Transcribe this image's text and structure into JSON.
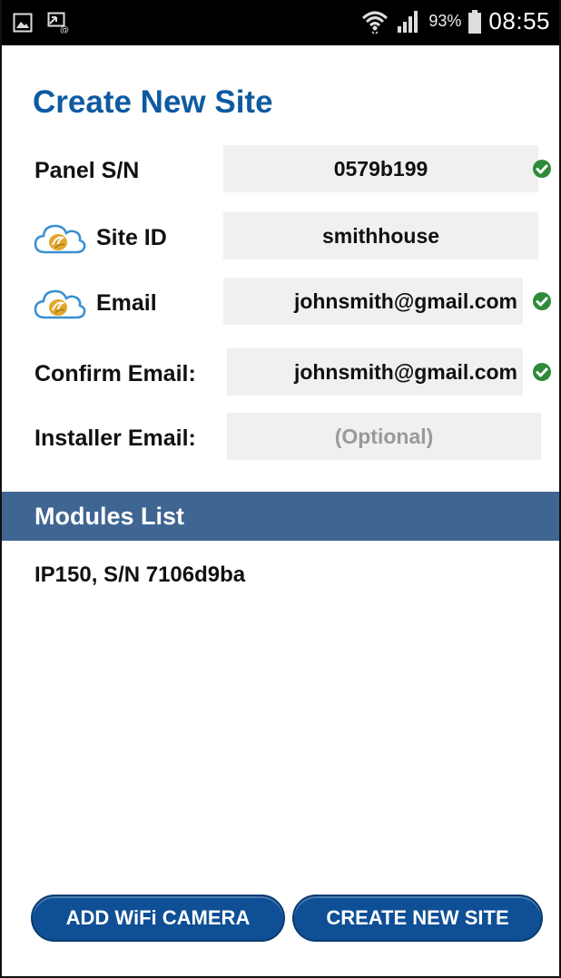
{
  "status_bar": {
    "left_icons": [
      "gallery-icon",
      "cast-mail-icon"
    ],
    "right_icons": [
      "wifi-icon",
      "signal-icon",
      "battery-icon"
    ],
    "battery_percent": "93%",
    "time": "08:55"
  },
  "page": {
    "title": "Create New Site"
  },
  "form": {
    "panel_sn": {
      "label": "Panel S/N",
      "value": "0579b199",
      "verified": true
    },
    "site_id": {
      "label": "Site ID",
      "value": "smithhouse",
      "verified": false
    },
    "email": {
      "label": "Email",
      "value": "johnsmith@gmail.com",
      "verified": true
    },
    "confirm_email": {
      "label": "Confirm Email:",
      "value": "johnsmith@gmail.com",
      "verified": true
    },
    "installer_email": {
      "label": "Installer Email:",
      "value": "",
      "placeholder": "(Optional)"
    }
  },
  "modules": {
    "header": "Modules List",
    "items": [
      "IP150, S/N 7106d9ba"
    ]
  },
  "buttons": {
    "add_camera": "ADD WiFi CAMERA",
    "create_site": "CREATE NEW SITE"
  },
  "colors": {
    "title": "#0e5aa0",
    "section_header": "#3f6592",
    "button": "#0e4f95",
    "check": "#2e8b3a",
    "field_bg": "#f0f0f0"
  }
}
